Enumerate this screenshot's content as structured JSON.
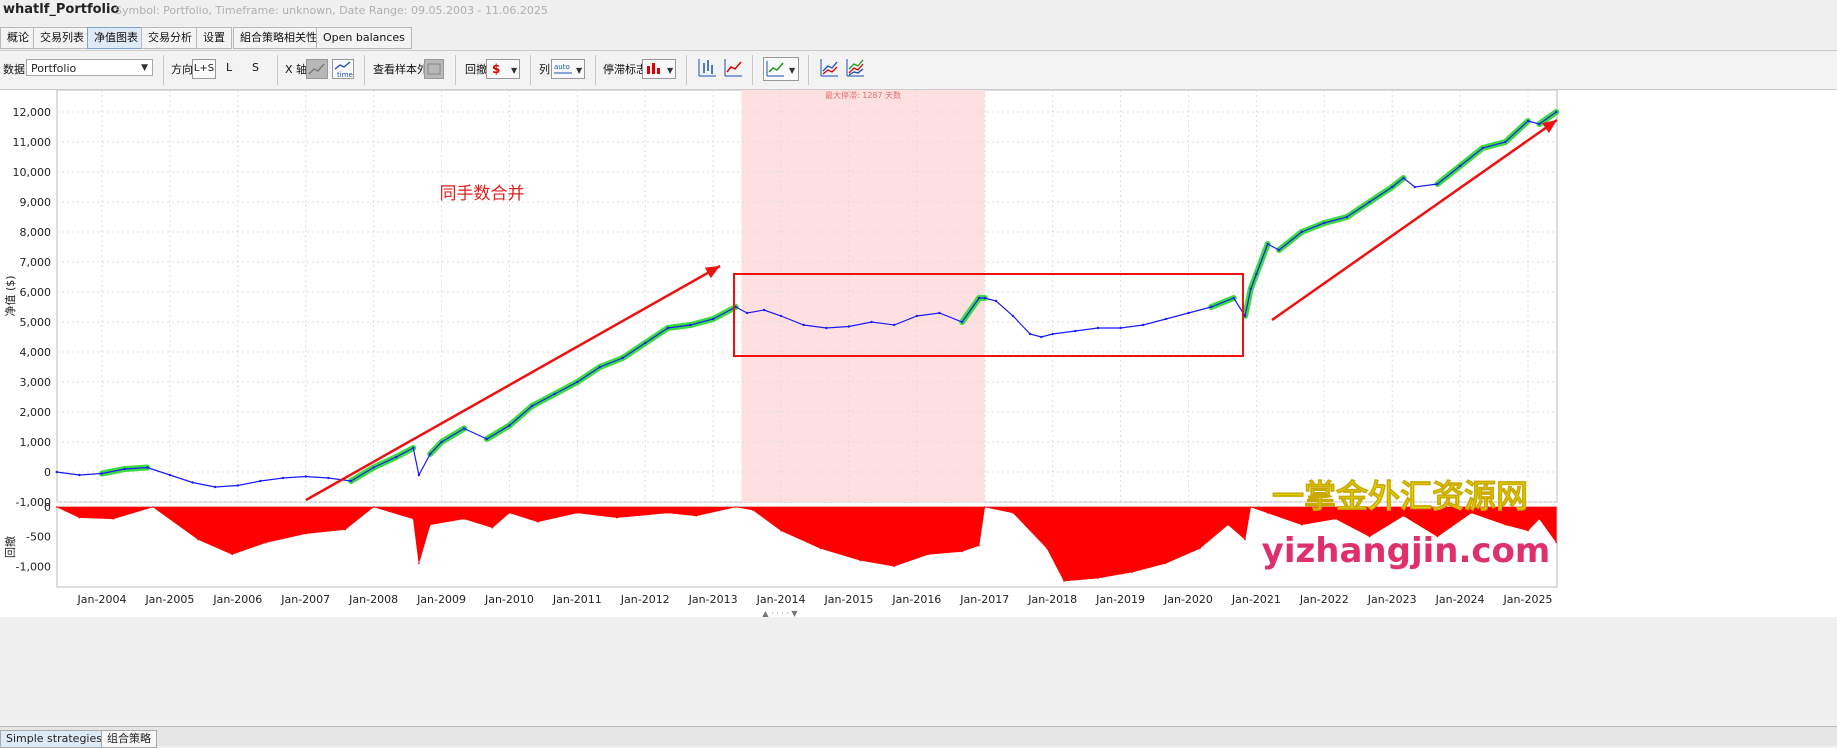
{
  "window": {
    "title": "whatlf_Portfolio",
    "subtitle": "Symbol: Portfolio, Timeframe: unknown, Date Range: 09.05.2003 - 11.06.2025"
  },
  "tabs": [
    "概论",
    "交易列表",
    "净值图表",
    "交易分析",
    "设置",
    "組合策略相关性",
    "Open balances"
  ],
  "active_tab": "净值图表",
  "toolbar": {
    "data_label": "数据",
    "data_value": "Portfolio",
    "direction_label": "方向",
    "dir_ls": "L+S",
    "dir_l": "L",
    "dir_s": "S",
    "xaxis_label": "X 轴",
    "time_label": "time",
    "oos_label": "查看样本外",
    "drawdown_label": "回撤",
    "dollar_label": "$",
    "column_label": "列",
    "auto_label": "auto",
    "stagnation_label": "停滞标志"
  },
  "bottom_tabs": [
    "Simple strategies",
    "组合策略"
  ],
  "chart_data": {
    "type": "line",
    "ylabel": "净值 ($)",
    "ylabel_bottom": "回撤",
    "y_ticks": [
      "12,000",
      "11,000",
      "10,000",
      "9,000",
      "8,000",
      "7,000",
      "6,000",
      "5,000",
      "4,000",
      "3,000",
      "2,000",
      "1,000",
      "0",
      "-1,000"
    ],
    "ylim": [
      -1000,
      12600
    ],
    "dd_ticks": [
      "0",
      "-500",
      "-1,000"
    ],
    "dd_ylim": [
      -1350,
      0
    ],
    "x_ticks": [
      "Jan-2004",
      "Jan-2005",
      "Jan-2006",
      "Jan-2007",
      "Jan-2008",
      "Jan-2009",
      "Jan-2010",
      "Jan-2011",
      "Jan-2012",
      "Jan-2013",
      "Jan-2014",
      "Jan-2015",
      "Jan-2016",
      "Jan-2017",
      "Jan-2018",
      "Jan-2019",
      "Jan-2020",
      "Jan-2021",
      "Jan-2022",
      "Jan-2023",
      "Jan-2024",
      "Jan-2025"
    ],
    "stagnation_label": "最大停滞: 1287 天数",
    "stagnation_period": [
      "2013-06",
      "2017-01"
    ],
    "annotation_text": "同手数合并",
    "watermark_cn": "一掌金外汇资源网",
    "watermark_url": "yizhangjin.com",
    "series": [
      {
        "color": "#1a1aff",
        "x": [
          "2003-05",
          "2003-09",
          "2004-01",
          "2004-05",
          "2004-09",
          "2005-01",
          "2005-05",
          "2005-09",
          "2006-01",
          "2006-05",
          "2006-09",
          "2007-01",
          "2007-05",
          "2007-09",
          "2008-01",
          "2008-05",
          "2008-08",
          "2008-09",
          "2008-11",
          "2009-01",
          "2009-05",
          "2009-09",
          "2010-01",
          "2010-05",
          "2010-09",
          "2011-01",
          "2011-05",
          "2011-09",
          "2012-01",
          "2012-05",
          "2012-09",
          "2013-01",
          "2013-05",
          "2013-07",
          "2013-10",
          "2014-01",
          "2014-05",
          "2014-09",
          "2015-01",
          "2015-05",
          "2015-09",
          "2016-01",
          "2016-05",
          "2016-09",
          "2016-12",
          "2017-01",
          "2017-03",
          "2017-06",
          "2017-09",
          "2017-11",
          "2018-01",
          "2018-05",
          "2018-09",
          "2019-01",
          "2019-05",
          "2019-09",
          "2020-01",
          "2020-05",
          "2020-09",
          "2020-11",
          "2020-12",
          "2021-01",
          "2021-03",
          "2021-05",
          "2021-09",
          "2022-01",
          "2022-05",
          "2022-09",
          "2023-01",
          "2023-03",
          "2023-05",
          "2023-09",
          "2024-01",
          "2024-05",
          "2024-09",
          "2025-01",
          "2025-03",
          "2025-06"
        ],
        "y": [
          0,
          -100,
          -50,
          100,
          150,
          -100,
          -350,
          -500,
          -450,
          -300,
          -200,
          -150,
          -200,
          -300,
          150,
          500,
          800,
          -100,
          600,
          1000,
          1450,
          1100,
          1550,
          2200,
          2600,
          3000,
          3500,
          3800,
          4300,
          4800,
          4900,
          5100,
          5500,
          5300,
          5400,
          5200,
          4900,
          4800,
          4850,
          5000,
          4900,
          5200,
          5300,
          5000,
          5800,
          5800,
          5700,
          5200,
          4600,
          4500,
          4600,
          4700,
          4800,
          4800,
          4900,
          5100,
          5300,
          5500,
          5800,
          5200,
          6100,
          6600,
          7600,
          7400,
          8000,
          8300,
          8500,
          9000,
          9500,
          9800,
          9500,
          9600,
          10200,
          10800,
          11000,
          11700,
          11600,
          12000
        ]
      }
    ],
    "drawdown": {
      "color": "#ff0000",
      "x": [
        "2003-05",
        "2003-09",
        "2004-03",
        "2004-10",
        "2005-06",
        "2005-12",
        "2006-06",
        "2007-01",
        "2007-08",
        "2008-01",
        "2008-08",
        "2008-09",
        "2008-11",
        "2009-05",
        "2009-10",
        "2010-01",
        "2010-06",
        "2011-01",
        "2011-08",
        "2012-05",
        "2012-10",
        "2013-05",
        "2013-08",
        "2014-01",
        "2014-08",
        "2015-03",
        "2015-09",
        "2016-03",
        "2016-09",
        "2016-12",
        "2017-01",
        "2017-06",
        "2017-12",
        "2018-03",
        "2018-09",
        "2019-03",
        "2019-09",
        "2020-03",
        "2020-08",
        "2020-11",
        "2020-12",
        "2021-03",
        "2021-09",
        "2022-03",
        "2022-09",
        "2023-03",
        "2023-09",
        "2024-03",
        "2024-09",
        "2025-01",
        "2025-03",
        "2025-06"
      ],
      "y": [
        0,
        -180,
        -200,
        0,
        -550,
        -800,
        -600,
        -450,
        -380,
        0,
        -200,
        -950,
        -300,
        -200,
        -350,
        -100,
        -250,
        -100,
        -180,
        -100,
        -150,
        0,
        -50,
        -400,
        -700,
        -900,
        -1000,
        -800,
        -750,
        -650,
        0,
        -100,
        -700,
        -1250,
        -1200,
        -1100,
        -950,
        -700,
        -300,
        -550,
        0,
        -100,
        -300,
        -200,
        -500,
        -150,
        -500,
        -100,
        -300,
        -400,
        -200,
        -600
      ]
    }
  }
}
